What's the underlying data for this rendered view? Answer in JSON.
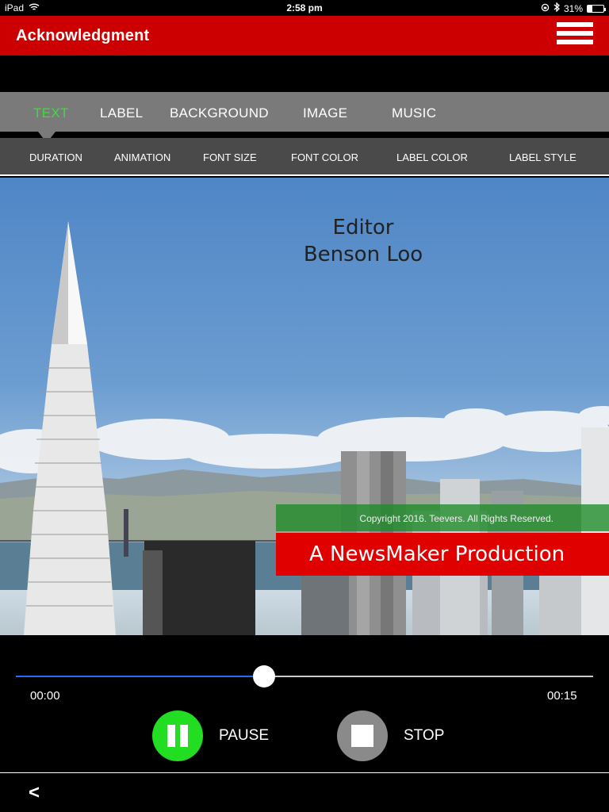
{
  "status_bar": {
    "device": "iPad",
    "time": "2:58 pm",
    "battery_text": "31%",
    "battery_level": 0.31
  },
  "header": {
    "title": "Acknowledgment",
    "menu_icon": "hamburger-menu-icon"
  },
  "main_tabs": [
    {
      "label": "TEXT",
      "active": true
    },
    {
      "label": "LABEL",
      "active": false
    },
    {
      "label": "BACKGROUND",
      "active": false
    },
    {
      "label": "IMAGE",
      "active": false
    },
    {
      "label": "MUSIC",
      "active": false
    }
  ],
  "sub_tabs": [
    {
      "label": "DURATION"
    },
    {
      "label": "ANIMATION"
    },
    {
      "label": "FONT SIZE"
    },
    {
      "label": "FONT COLOR"
    },
    {
      "label": "LABEL COLOR"
    },
    {
      "label": "LABEL STYLE"
    }
  ],
  "preview": {
    "line1": "Editor",
    "line2": "Benson Loo",
    "copyright": "Copyright 2016. Teevers. All Rights Reserved.",
    "production": "A NewsMaker Production"
  },
  "player": {
    "current_time": "00:00",
    "end_time": "00:15",
    "progress": 0.43,
    "pause_label": "PAUSE",
    "stop_label": "STOP"
  },
  "footer": {
    "back_label": "<"
  },
  "colors": {
    "header_red": "#cc0000",
    "active_tab_green": "#3cdc3c",
    "pause_green": "#22dd22",
    "progress_blue": "#1e6fff",
    "copyright_green": "#1e8c28",
    "production_red": "#e00000"
  }
}
